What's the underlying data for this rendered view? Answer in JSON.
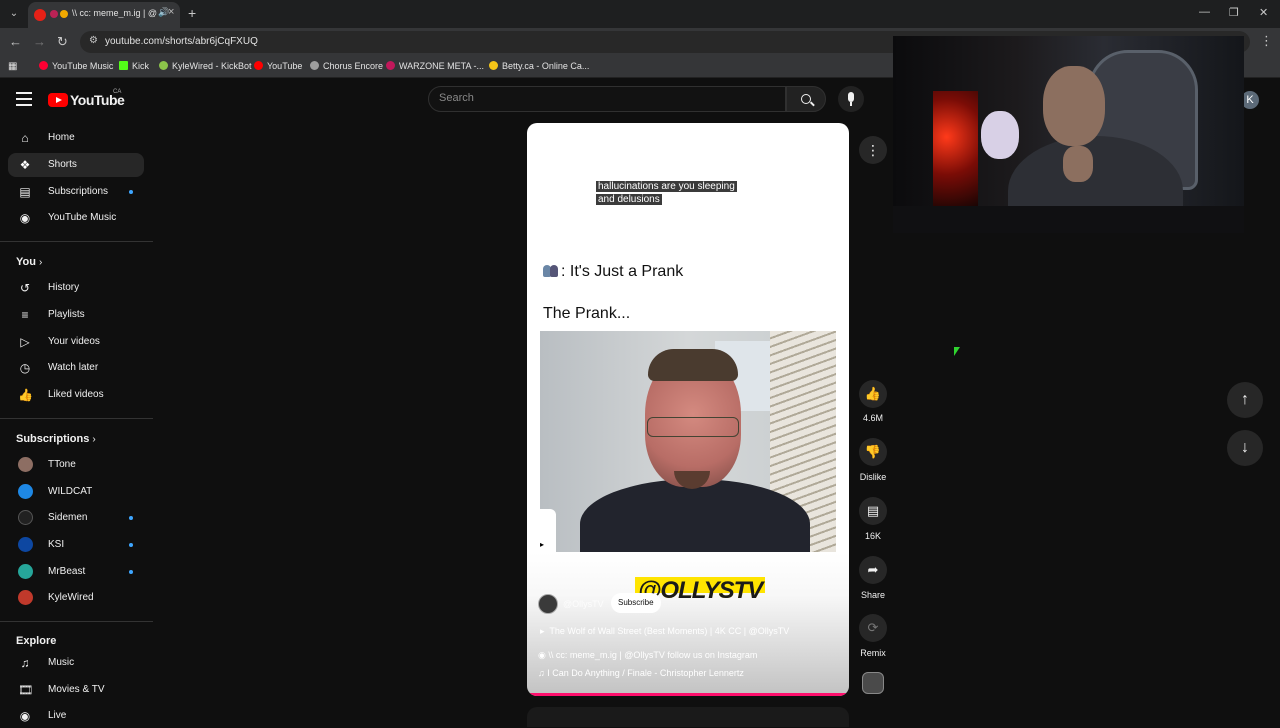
{
  "browser": {
    "tab_title": "\\\\ cc: meme_m.ig | @",
    "url": "youtube.com/shorts/abr6jCqFXUQ",
    "bookmarks": [
      {
        "label": "YouTube Music",
        "color": "#ff0033"
      },
      {
        "label": "Kick",
        "color": "#53fc18"
      },
      {
        "label": "KyleWired - KickBot",
        "color": "#8bc34a"
      },
      {
        "label": "YouTube",
        "color": "#ff0000"
      },
      {
        "label": "Chorus Encore",
        "color": "#9e9e9e"
      },
      {
        "label": "WARZONE META -...",
        "color": "#c2185b"
      },
      {
        "label": "Betty.ca - Online Ca...",
        "color": "#f5c518"
      }
    ]
  },
  "header": {
    "logo_text": "YouTube",
    "region": "CA",
    "search_placeholder": "Search",
    "avatar_letter": "K"
  },
  "sidebar": {
    "main": [
      {
        "label": "Home",
        "icon": "home-icon"
      },
      {
        "label": "Shorts",
        "icon": "shorts-icon",
        "active": true
      },
      {
        "label": "Subscriptions",
        "icon": "subscriptions-icon",
        "dot": true
      },
      {
        "label": "YouTube Music",
        "icon": "music-icon"
      }
    ],
    "you_heading": "You",
    "you": [
      {
        "label": "History",
        "icon": "history-icon"
      },
      {
        "label": "Playlists",
        "icon": "playlists-icon"
      },
      {
        "label": "Your videos",
        "icon": "your-videos-icon"
      },
      {
        "label": "Watch later",
        "icon": "watch-later-icon"
      },
      {
        "label": "Liked videos",
        "icon": "liked-videos-icon"
      }
    ],
    "subscriptions_heading": "Subscriptions",
    "subscriptions": [
      {
        "label": "TTone",
        "color": "#8d6e63",
        "dot": false
      },
      {
        "label": "WILDCAT",
        "color": "#1e88e5",
        "dot": false
      },
      {
        "label": "Sidemen",
        "color": "#212121",
        "dot": true
      },
      {
        "label": "KSI",
        "color": "#0d47a1",
        "dot": true
      },
      {
        "label": "MrBeast",
        "color": "#26a69a",
        "dot": true
      },
      {
        "label": "KyleWired",
        "color": "#c0392b",
        "dot": false
      }
    ],
    "explore_heading": "Explore",
    "explore": [
      {
        "label": "Music",
        "icon": "music-note-icon"
      },
      {
        "label": "Movies & TV",
        "icon": "movies-icon"
      },
      {
        "label": "Live",
        "icon": "live-icon"
      }
    ]
  },
  "short": {
    "caption_line1": "hallucinations are you sleeping",
    "caption_line2": "and delusions",
    "meme_title": ": It's Just a Prank",
    "meme_subtitle": "The Prank...",
    "watermark": "@OLLYSTV",
    "channel": "@OllysTV",
    "subscribe_label": "Subscribe",
    "related_video": "The Wolf of Wall Street (Best Moments) | 4K CC | @OllysTV",
    "description": "\\\\ cc: meme_m.ig | @OllysTV follow us on Instagram",
    "sound": "I Can Do Anything / Finale - Christopher Lennertz"
  },
  "actions": {
    "likes": "4.6M",
    "dislike_label": "Dislike",
    "comments": "16K",
    "share_label": "Share",
    "remix_label": "Remix"
  },
  "colors": {
    "accent": "#ff0000",
    "progress": "#ff0f6d",
    "unread_dot": "#3ea6ff"
  }
}
